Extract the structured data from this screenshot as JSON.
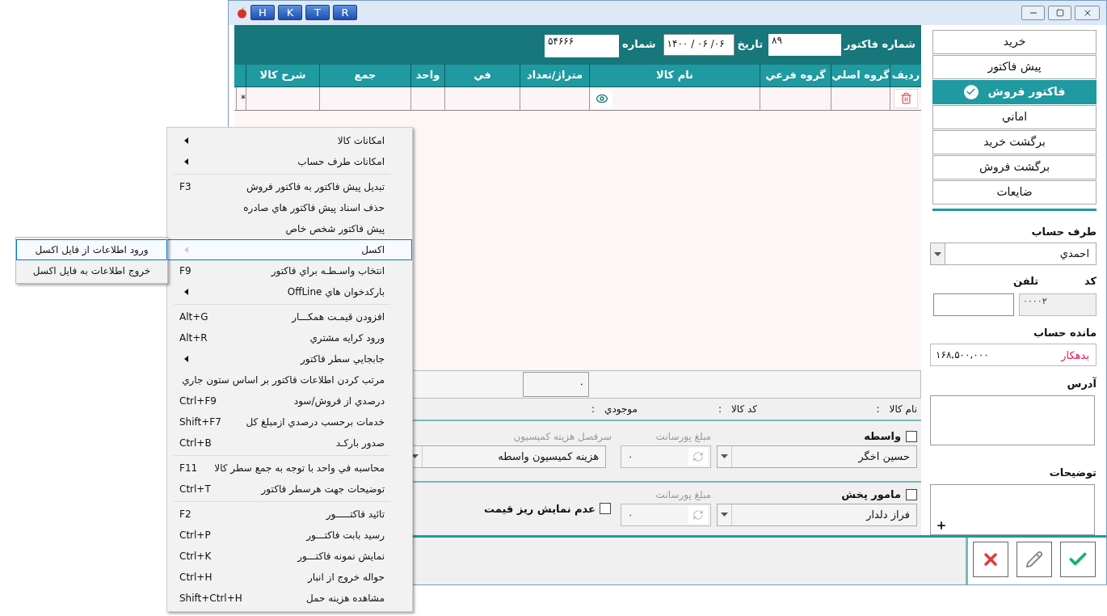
{
  "title_bar": {
    "buttons": [
      "R",
      "T",
      "K",
      "H"
    ]
  },
  "header": {
    "invoice_number_label": "شماره فاکتور",
    "invoice_number": "۸۹",
    "date_label": "تاريخ",
    "date": "۱۴۰۰ / ۰۶ /۰۶",
    "number_label": "شماره",
    "number": "۵۴۶۶۶"
  },
  "table": {
    "columns": [
      "رديف",
      "گروه اصلي",
      "گروه فرعي",
      "نام کالا",
      "متراژ/تعداد",
      "في",
      "واحد",
      "جمع",
      "شرح کالا"
    ],
    "new_row_marker": "*"
  },
  "totals": {
    "value": "۰"
  },
  "item_info": [
    {
      "label": "نام کالا",
      "separator": ":"
    },
    {
      "label": "کد کالا",
      "separator": ":"
    },
    {
      "label": "موجودي",
      "separator": ":"
    }
  ],
  "broker": {
    "label": "واسطه",
    "checked": false,
    "commission_label": "مبلغ پورسانت",
    "account_label": "سرفصل هزينه کميسيون",
    "person": "حسين اخگر",
    "amount": "۰",
    "account": "هزينه کميسيون واسطه"
  },
  "distributor": {
    "label": "مامور پخش",
    "checked": false,
    "commission_label": "مبلغ پورسانت",
    "person": "فراز دلدار",
    "amount": "۰",
    "hide_price_details": {
      "label": "عدم نمايش ريز قيمت",
      "checked": false
    }
  },
  "sidebar": {
    "doc_types": [
      {
        "label": "خريد",
        "selected": false
      },
      {
        "label": "پيش فاکتور",
        "selected": false
      },
      {
        "label": "فاکتور فروش",
        "selected": true
      },
      {
        "label": "اماني",
        "selected": false
      },
      {
        "label": "برگشت خريد",
        "selected": false
      },
      {
        "label": "برگشت فروش",
        "selected": false
      },
      {
        "label": "ضايعات",
        "selected": false
      }
    ],
    "account_label": "طرف حساب",
    "account": "احمدي",
    "code_label": "کد",
    "phone_label": "تلفن",
    "code": "۰۰۰۰۲",
    "balance_label": "مانده حساب",
    "balance_status": "بدهکار",
    "balance": "۱۶۸,۵۰۰,۰۰۰",
    "address_label": "آدرس",
    "notes_label": "توضيحات"
  },
  "context_menu": {
    "items": [
      {
        "kind": "item",
        "label": "امکانات کالا",
        "submenu": true,
        "selected": false
      },
      {
        "kind": "item",
        "label": "امکانات طرف حساب",
        "submenu": true,
        "selected": false
      },
      {
        "kind": "separator"
      },
      {
        "kind": "item",
        "label": "تبديل پيش فاکتور به فاکتور فروش",
        "shortcut": "F3",
        "selected": false
      },
      {
        "kind": "item",
        "label": "حذف اسناد پيش فاکتور هاي صادره",
        "selected": false
      },
      {
        "kind": "item",
        "label": "پيش فاکتور شخص خاص",
        "selected": false
      },
      {
        "kind": "item",
        "label": "اکسل",
        "submenu": true,
        "selected": true
      },
      {
        "kind": "item",
        "label": "انتخاب واسـطـه براي فاکتور",
        "shortcut": "F9",
        "selected": false
      },
      {
        "kind": "item",
        "label": "بارکدخوان هاي OffLine",
        "submenu": true,
        "selected": false
      },
      {
        "kind": "separator"
      },
      {
        "kind": "item",
        "label": "افزودن قيمـت همکـــار",
        "shortcut": "Alt+G",
        "selected": false
      },
      {
        "kind": "item",
        "label": "ورود کرايه مشتري",
        "shortcut": "Alt+R",
        "selected": false
      },
      {
        "kind": "item",
        "label": "جابجايي سطر فاکتور",
        "submenu": true,
        "selected": false
      },
      {
        "kind": "item",
        "label": "مرتب کردن اطلاعات فاکتور بر اساس ستون جاري",
        "selected": false
      },
      {
        "kind": "item",
        "label": "درصدي از فروش/سود",
        "shortcut": "Ctrl+F9",
        "selected": false
      },
      {
        "kind": "item",
        "label": "خدمات برحسب درصدي ازمبلغ کل",
        "shortcut": "Shift+F7",
        "selected": false
      },
      {
        "kind": "item",
        "label": "صدور بارکـد",
        "shortcut": "Ctrl+B",
        "selected": false
      },
      {
        "kind": "separator"
      },
      {
        "kind": "item",
        "label": "محاسبه في واحد با توجه به جمع سطر کالا",
        "shortcut": "F11",
        "selected": false
      },
      {
        "kind": "item",
        "label": "توضيحات جهت هرسطر فاکتور",
        "shortcut": "Ctrl+T",
        "selected": false
      },
      {
        "kind": "separator"
      },
      {
        "kind": "item",
        "label": "تائيد فاکتـــــور",
        "shortcut": "F2",
        "selected": false
      },
      {
        "kind": "item",
        "label": "رسيد بابت فاکتـــور",
        "shortcut": "Ctrl+P",
        "selected": false
      },
      {
        "kind": "item",
        "label": "نمايش نمونه فاکتـــور",
        "shortcut": "Ctrl+K",
        "selected": false
      },
      {
        "kind": "item",
        "label": "حواله خروج از انبار",
        "shortcut": "Ctrl+H",
        "selected": false
      },
      {
        "kind": "item",
        "label": "مشاهده هزينه حمل",
        "shortcut": "Shift+Ctrl+H",
        "selected": false
      }
    ]
  },
  "submenu": {
    "items": [
      {
        "label": "ورود اطلاعات از فايل اکسل",
        "selected": true
      },
      {
        "label": "خروج اطلاعات به فايل اکسل",
        "selected": false
      }
    ]
  }
}
